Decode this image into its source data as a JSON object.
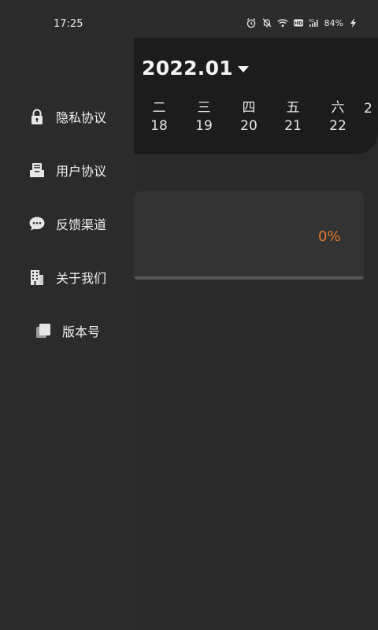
{
  "status_bar": {
    "time": "17:25",
    "battery": "84%",
    "icons": [
      "alarm-icon",
      "bell-off-icon",
      "wifi-icon",
      "hd-icon",
      "signal-icon",
      "charging-icon"
    ],
    "signal_label": "5G"
  },
  "calendar": {
    "month_label": "2022.01",
    "days": [
      {
        "dow": "二",
        "date": "18"
      },
      {
        "dow": "三",
        "date": "19"
      },
      {
        "dow": "四",
        "date": "20"
      },
      {
        "dow": "五",
        "date": "21"
      },
      {
        "dow": "六",
        "date": "22"
      }
    ],
    "partial_day": {
      "dow": "",
      "date": "2"
    }
  },
  "progress": {
    "percent_label": "0%",
    "value": 0
  },
  "drawer": {
    "items": [
      {
        "label": "隐私协议",
        "icon": "lock-icon"
      },
      {
        "label": "用户协议",
        "icon": "document-tray-icon"
      },
      {
        "label": "反馈渠道",
        "icon": "chat-bubble-icon"
      },
      {
        "label": "关于我们",
        "icon": "building-icon"
      },
      {
        "label": "版本号",
        "icon": "copy-pages-icon"
      }
    ]
  },
  "colors": {
    "accent": "#e5772e",
    "drawer_bg": "#2b2b2b",
    "calendar_bg": "#1c1c1c",
    "card_bg": "#333333"
  }
}
